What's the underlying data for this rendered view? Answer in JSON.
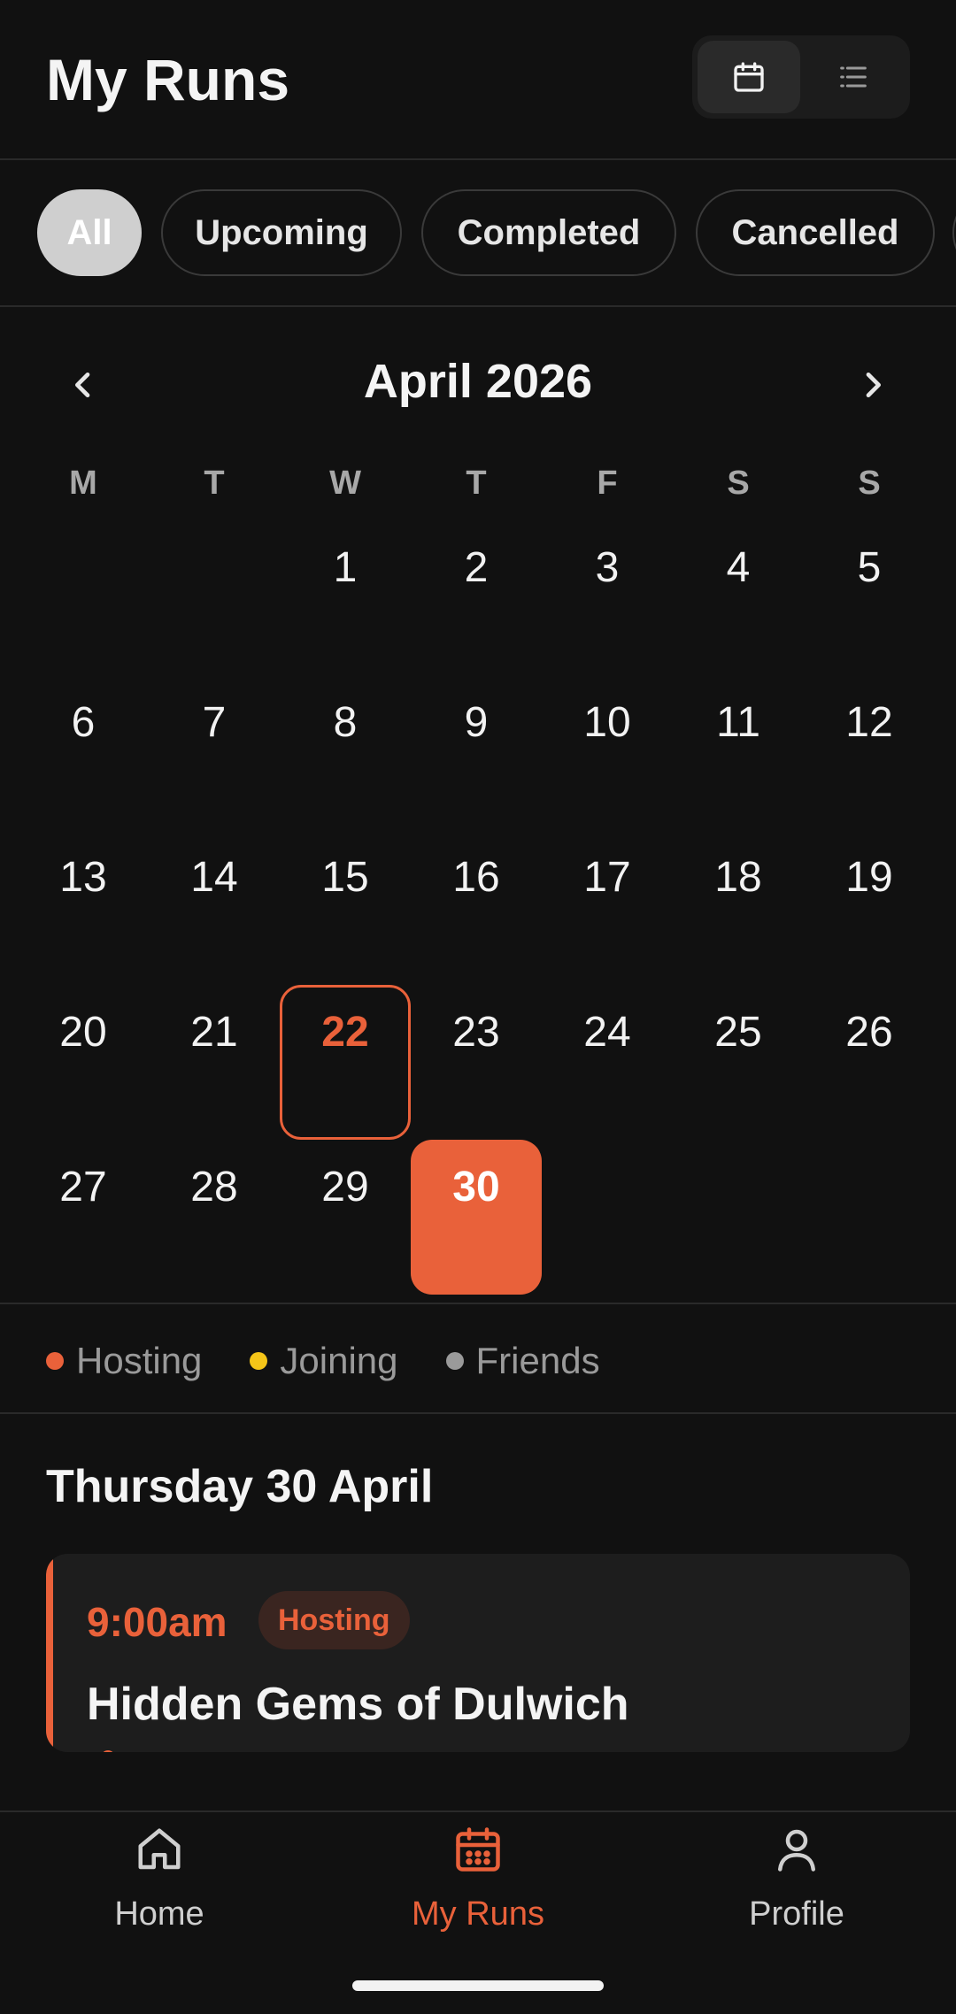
{
  "header": {
    "title": "My Runs"
  },
  "view_toggle": {
    "calendar_icon": "calendar-icon",
    "list_icon": "list-icon",
    "active": "calendar"
  },
  "filters": [
    {
      "label": "All",
      "active": true
    },
    {
      "label": "Upcoming",
      "active": false
    },
    {
      "label": "Completed",
      "active": false
    },
    {
      "label": "Cancelled",
      "active": false
    }
  ],
  "calendar": {
    "month_label": "April 2026",
    "weekdays": [
      "M",
      "T",
      "W",
      "T",
      "F",
      "S",
      "S"
    ],
    "leading_blanks": 2,
    "days": [
      "1",
      "2",
      "3",
      "4",
      "5",
      "6",
      "7",
      "8",
      "9",
      "10",
      "11",
      "12",
      "13",
      "14",
      "15",
      "16",
      "17",
      "18",
      "19",
      "20",
      "21",
      "22",
      "23",
      "24",
      "25",
      "26",
      "27",
      "28",
      "29",
      "30"
    ],
    "today": "22",
    "selected": "30"
  },
  "legend": [
    {
      "label": "Hosting",
      "color": "#e9613a"
    },
    {
      "label": "Joining",
      "color": "#f5c518"
    },
    {
      "label": "Friends",
      "color": "#9a9a9a"
    }
  ],
  "selected_day": {
    "heading": "Thursday 30 April",
    "events": [
      {
        "time": "9:00am",
        "badge": "Hosting",
        "title": "Hidden Gems of Dulwich"
      }
    ]
  },
  "bottom_nav": [
    {
      "label": "Home",
      "icon": "home-icon",
      "active": false
    },
    {
      "label": "My Runs",
      "icon": "calendar-icon",
      "active": true
    },
    {
      "label": "Profile",
      "icon": "profile-icon",
      "active": false
    }
  ],
  "colors": {
    "accent": "#e9613a",
    "background": "#111111",
    "card": "#1d1d1d"
  }
}
